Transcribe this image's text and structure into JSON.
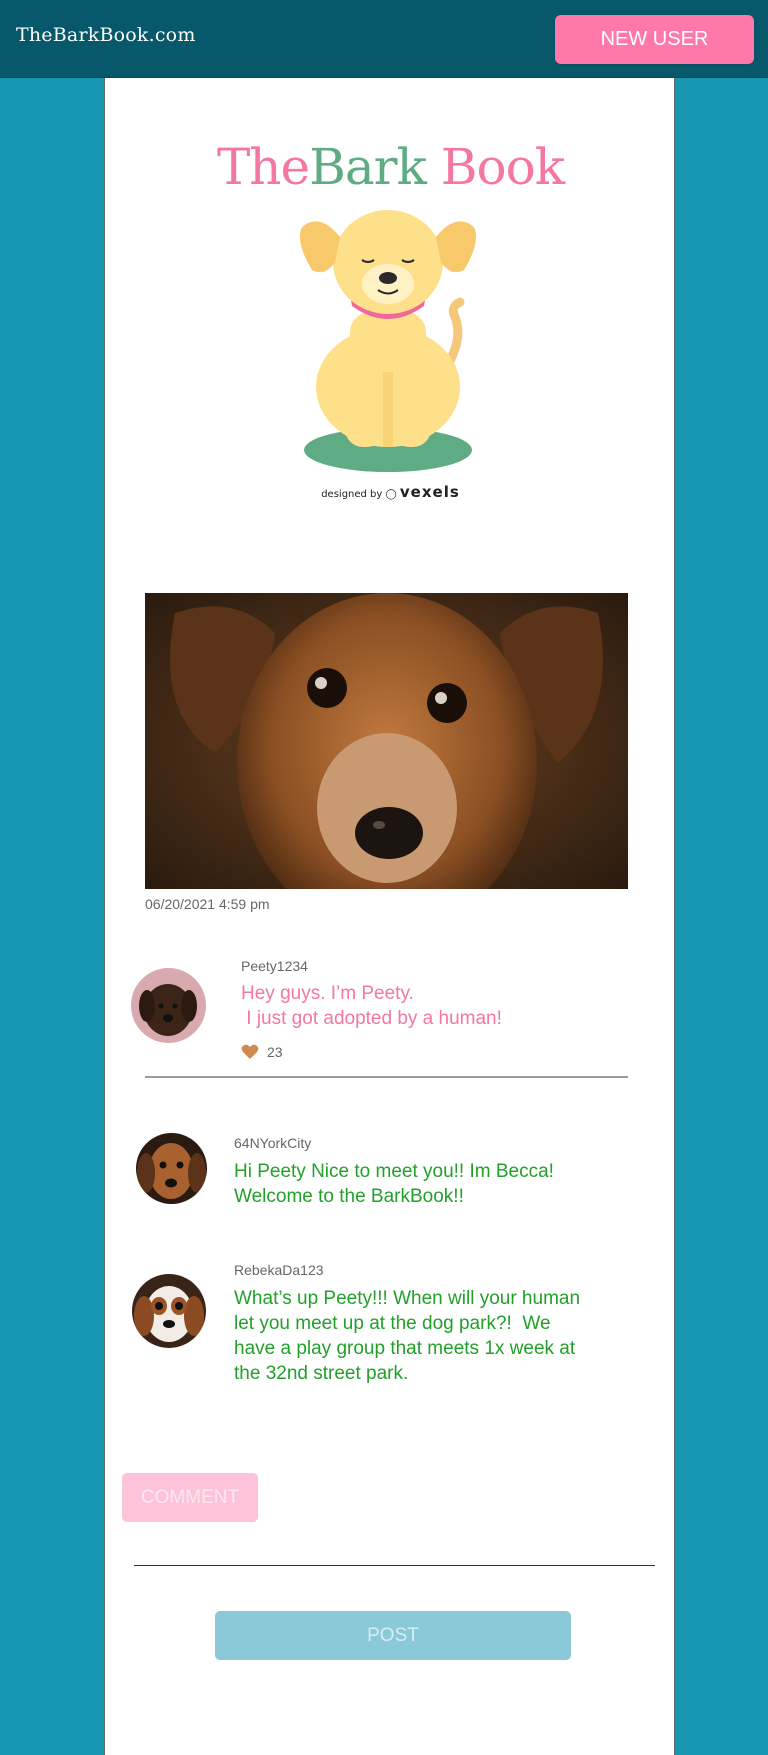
{
  "header": {
    "site_name": "TheBarkBook.com",
    "new_user_label": "NEW USER"
  },
  "logo": {
    "title_part1": "The",
    "title_part2": "Bark",
    "title_part3": "Book",
    "credit_prefix": "designed by",
    "credit_brand": "vexels"
  },
  "post": {
    "timestamp": "06/20/2021 4:59 pm"
  },
  "comments": [
    {
      "username": "Peety1234",
      "text": "Hey guys. I’m Peety.\n I just got adopted by a human!",
      "likes": "23",
      "color": "#f4779f"
    },
    {
      "username": "64NYorkCity",
      "text": "Hi Peety Nice to meet you!! Im Becca!\nWelcome to the BarkBook!!",
      "color": "#22a02a"
    },
    {
      "username": "RebekaDa123",
      "text": "What’s up Peety!!! When will your human\nlet you meet up at the dog park?!  We\nhave a play group that meets 1x week at\nthe 32nd street park.",
      "color": "#22a02a"
    }
  ],
  "actions": {
    "comment_label": "COMMENT",
    "post_label": "POST"
  },
  "colors": {
    "header_bg": "#07586b",
    "page_bg": "#1796b1",
    "brand_pink": "#f4779f",
    "brand_green": "#5eab84",
    "comment_green": "#22a02a"
  }
}
